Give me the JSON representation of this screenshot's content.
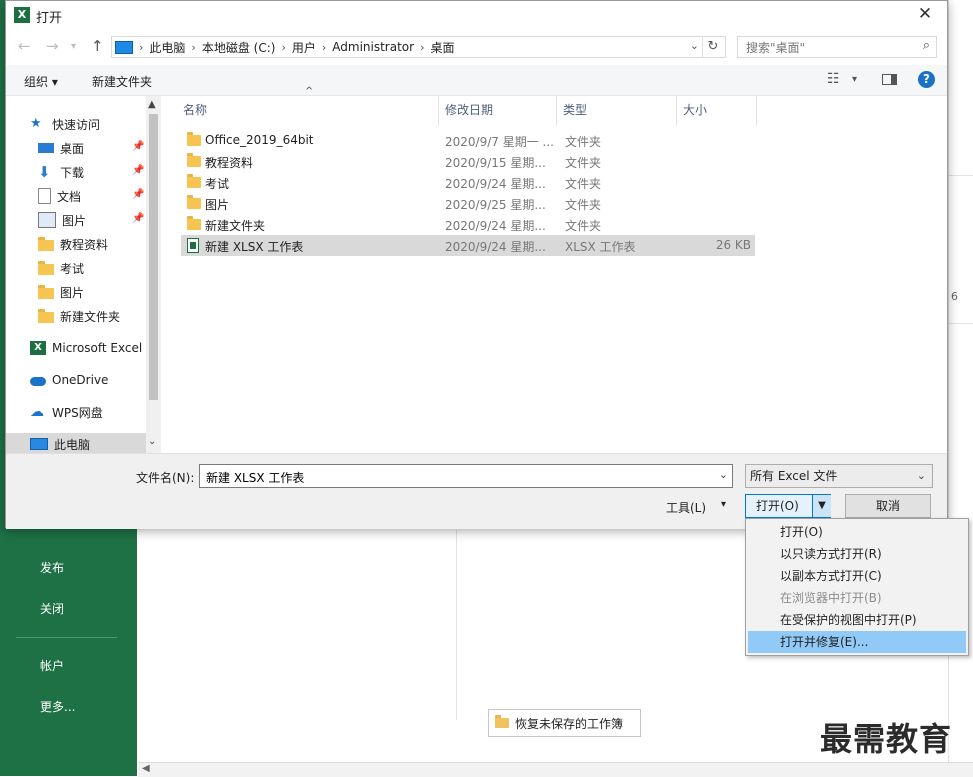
{
  "background": {
    "nav_items": [
      "发布",
      "关闭",
      "帐户",
      "更多..."
    ],
    "right_fragment": "6",
    "recover_button": "恢复未保存的工作簿",
    "watermark": "最需教育"
  },
  "dialog": {
    "title": "打开",
    "close_glyph": "✕",
    "address": {
      "crumbs": [
        "此电脑",
        "本地磁盘 (C:)",
        "用户",
        "Administrator",
        "桌面"
      ]
    },
    "search": {
      "placeholder": "搜索\"桌面\""
    },
    "toolbar": {
      "organize": "组织",
      "new_folder": "新建文件夹"
    },
    "nav_tree": [
      {
        "label": "快速访问",
        "icon": "star-icon"
      },
      {
        "label": "桌面",
        "icon": "desktop-icon",
        "pinned": true
      },
      {
        "label": "下载",
        "icon": "download-icon",
        "pinned": true
      },
      {
        "label": "文档",
        "icon": "document-icon",
        "pinned": true
      },
      {
        "label": "图片",
        "icon": "pictures-icon",
        "pinned": true
      },
      {
        "label": "教程资料",
        "icon": "folder-icon"
      },
      {
        "label": "考试",
        "icon": "folder-icon"
      },
      {
        "label": "图片",
        "icon": "folder-icon"
      },
      {
        "label": "新建文件夹",
        "icon": "folder-icon"
      },
      {
        "label": "Microsoft Excel",
        "icon": "excel-icon"
      },
      {
        "label": "OneDrive",
        "icon": "cloud-icon"
      },
      {
        "label": "WPS网盘",
        "icon": "wps-cloud-icon"
      },
      {
        "label": "此电脑",
        "icon": "computer-icon",
        "selected": true
      }
    ],
    "columns": {
      "name": "名称",
      "date": "修改日期",
      "type": "类型",
      "size": "大小"
    },
    "files": [
      {
        "name": "Office_2019_64bit",
        "date": "2020/9/7 星期一 ...",
        "type": "文件夹",
        "size": "",
        "icon": "folder-icon"
      },
      {
        "name": "教程资料",
        "date": "2020/9/15 星期...",
        "type": "文件夹",
        "size": "",
        "icon": "folder-icon"
      },
      {
        "name": "考试",
        "date": "2020/9/24 星期...",
        "type": "文件夹",
        "size": "",
        "icon": "folder-icon"
      },
      {
        "name": "图片",
        "date": "2020/9/25 星期...",
        "type": "文件夹",
        "size": "",
        "icon": "folder-icon"
      },
      {
        "name": "新建文件夹",
        "date": "2020/9/24 星期...",
        "type": "文件夹",
        "size": "",
        "icon": "folder-icon"
      },
      {
        "name": "新建 XLSX 工作表",
        "date": "2020/9/24 星期...",
        "type": "XLSX 工作表",
        "size": "26 KB",
        "icon": "xlsx-file-icon",
        "selected": true
      }
    ],
    "filename_label": "文件名(N):",
    "filename_value": "新建 XLSX 工作表",
    "filetype_value": "所有 Excel 文件",
    "tools_label": "工具(L)",
    "open_label": "打开(O)",
    "cancel_label": "取消"
  },
  "open_menu": [
    {
      "label": "打开(O)",
      "enabled": true
    },
    {
      "label": "以只读方式打开(R)",
      "enabled": true
    },
    {
      "label": "以副本方式打开(C)",
      "enabled": true
    },
    {
      "label": "在浏览器中打开(B)",
      "enabled": false
    },
    {
      "label": "在受保护的视图中打开(P)",
      "enabled": true
    },
    {
      "label": "打开并修复(E)...",
      "enabled": true,
      "highlighted": true
    }
  ],
  "colors": {
    "excel_green": "#1e7145",
    "accent_blue": "#0078d7",
    "menu_highlight": "#91c9f7"
  }
}
